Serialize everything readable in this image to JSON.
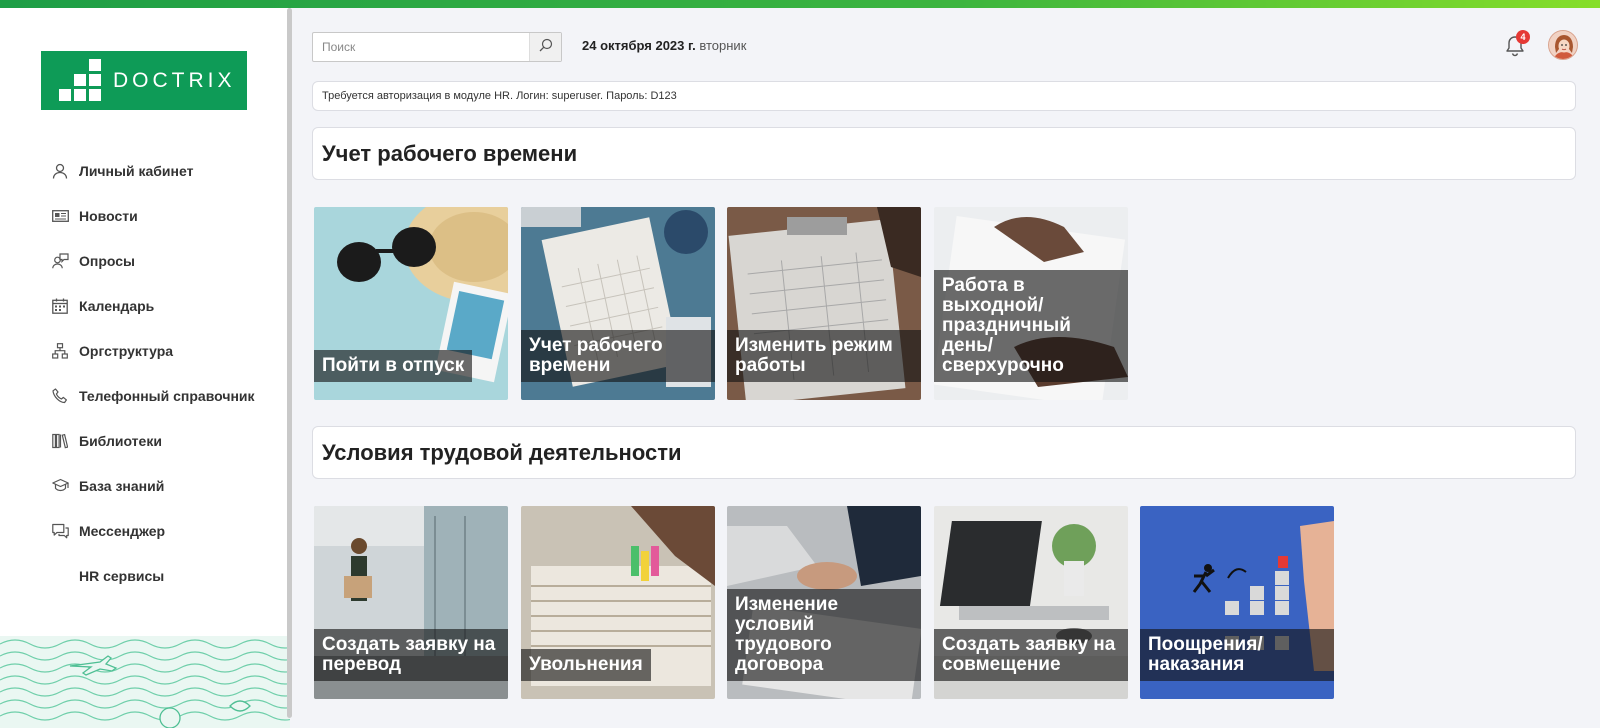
{
  "brand": {
    "logo_text": "DOCTRIX",
    "accent": "#0e9b57"
  },
  "sidebar": {
    "items": [
      {
        "label": "Личный кабинет",
        "icon": "user-icon"
      },
      {
        "label": "Новости",
        "icon": "news-icon"
      },
      {
        "label": "Опросы",
        "icon": "poll-icon"
      },
      {
        "label": "Календарь",
        "icon": "calendar-icon"
      },
      {
        "label": "Оргструктура",
        "icon": "org-structure-icon"
      },
      {
        "label": "Телефонный справочник",
        "icon": "phone-icon"
      },
      {
        "label": "Библиотеки",
        "icon": "library-icon"
      },
      {
        "label": "База знаний",
        "icon": "graduation-cap-icon"
      },
      {
        "label": "Мессенджер",
        "icon": "chat-icon"
      },
      {
        "label": "HR сервисы",
        "icon": ""
      }
    ]
  },
  "header": {
    "search_placeholder": "Поиск",
    "date_bold": "24 октября 2023 г.",
    "weekday": "вторник",
    "notifications_count": "4"
  },
  "notice": "Требуется авторизация в модуле HR. Логин: superuser. Пароль: D123",
  "sections": [
    {
      "title": "Учет рабочего времени",
      "tiles": [
        {
          "caption": "Пойти в отпуск"
        },
        {
          "caption": "Учет рабочего времени"
        },
        {
          "caption": "Изменить режим работы"
        },
        {
          "caption": "Работа в выходной/ праздничный день/ сверхурочно"
        }
      ]
    },
    {
      "title": "Условия трудовой деятельности",
      "tiles": [
        {
          "caption": "Создать заявку на перевод"
        },
        {
          "caption": "Увольнения"
        },
        {
          "caption": "Изменение условий трудового договора"
        },
        {
          "caption": "Создать заявку на совмещение"
        },
        {
          "caption": "Поощрения/ наказания"
        }
      ]
    }
  ]
}
